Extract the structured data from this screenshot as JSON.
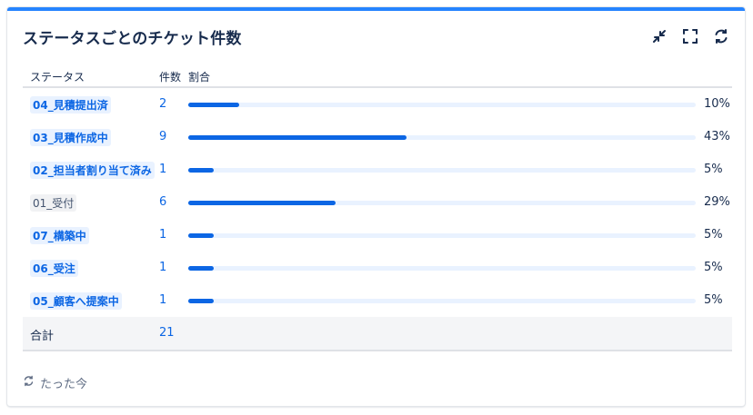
{
  "gadget": {
    "title": "ステータスごとのチケット件数",
    "icons": [
      "minimize-icon",
      "fullscreen-icon",
      "refresh-icon"
    ]
  },
  "columns": {
    "status": "ステータス",
    "count": "件数",
    "ratio": "割合"
  },
  "rows": [
    {
      "status": "04_見積提出済",
      "count": "2",
      "percent": "10%",
      "ratio": 0.1,
      "style": "blue"
    },
    {
      "status": "03_見積作成中",
      "count": "9",
      "percent": "43%",
      "ratio": 0.43,
      "style": "blue"
    },
    {
      "status": "02_担当者割り当て済み",
      "count": "1",
      "percent": "5%",
      "ratio": 0.05,
      "style": "blue"
    },
    {
      "status": "01_受付",
      "count": "6",
      "percent": "29%",
      "ratio": 0.29,
      "style": "grey"
    },
    {
      "status": "07_構築中",
      "count": "1",
      "percent": "5%",
      "ratio": 0.05,
      "style": "blue"
    },
    {
      "status": "06_受注",
      "count": "1",
      "percent": "5%",
      "ratio": 0.05,
      "style": "blue"
    },
    {
      "status": "05_顧客へ提案中",
      "count": "1",
      "percent": "5%",
      "ratio": 0.05,
      "style": "blue"
    }
  ],
  "total": {
    "label": "合計",
    "count": "21"
  },
  "footer": {
    "updated": "たった今"
  },
  "colors": {
    "accent": "#2684ff",
    "bar": "#0c66e4",
    "track": "#e9f2ff",
    "text": "#172b4d",
    "muted": "#626f86"
  }
}
